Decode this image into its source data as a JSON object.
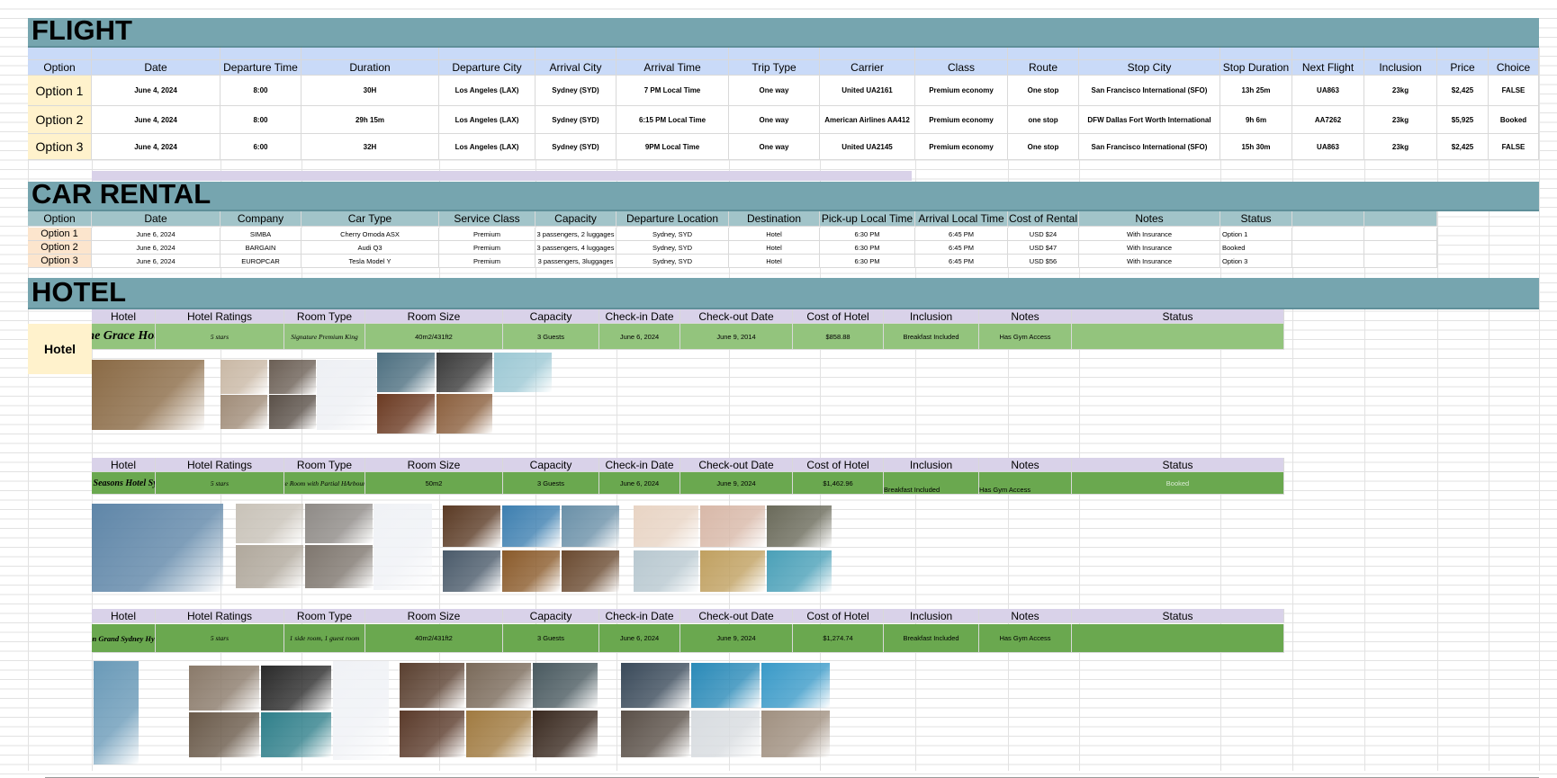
{
  "flight": {
    "title": "FLIGHT",
    "headers": [
      "Option",
      "Date",
      "Departure Time",
      "Duration",
      "Departure City",
      "Arrival City",
      "Arrival Time",
      "Trip Type",
      "Carrier",
      "Class",
      "Route",
      "Stop City",
      "Stop Duration",
      "Next Flight",
      "Inclusion",
      "Price",
      "Choice"
    ],
    "rows": [
      [
        "Option 1",
        "June 4, 2024",
        "8:00",
        "30H",
        "Los Angeles (LAX)",
        "Sydney (SYD)",
        "7 PM Local Time",
        "One way",
        "United UA2161",
        "Premium economy",
        "One stop",
        "San Francisco International (SFO)",
        "13h 25m",
        "UA863",
        "23kg",
        "$2,425",
        "FALSE"
      ],
      [
        "Option 2",
        "June 4, 2024",
        "8:00",
        "29h 15m",
        "Los Angeles (LAX)",
        "Sydney (SYD)",
        "6:15 PM Local Time",
        "One way",
        "American Airlines AA412",
        "Premium economy",
        "one stop",
        "DFW Dallas Fort Worth International",
        "9h 6m",
        "AA7262",
        "23kg",
        "$5,925",
        "Booked"
      ],
      [
        "Option 3",
        "June 4, 2024",
        "6:00",
        "32H",
        "Los Angeles (LAX)",
        "Sydney (SYD)",
        "9PM Local Time",
        "One way",
        "United UA2145",
        "Premium economy",
        "One stop",
        "San Francisco International (SFO)",
        "15h 30m",
        "UA863",
        "23kg",
        "$2,425",
        "FALSE"
      ]
    ]
  },
  "car_rental": {
    "title": "CAR RENTAL",
    "headers": [
      "Option",
      "Date",
      "Company",
      "Car Type",
      "Service Class",
      "Capacity",
      "Departure Location",
      "Destination",
      "Pick-up Local Time",
      "Arrival Local Time",
      "Cost of Rental",
      "Notes",
      "Status",
      "",
      ""
    ],
    "rows": [
      [
        "Option 1",
        "June 6, 2024",
        "SIMBA",
        "Cherry Omoda ASX",
        "Premium",
        "3 passengers, 2 luggages",
        "Sydney, SYD",
        "Hotel",
        "6:30 PM",
        "6:45 PM",
        "USD $24",
        "With Insurance",
        "Option 1"
      ],
      [
        "Option 2",
        "June 6, 2024",
        "BARGAIN",
        "Audi Q3",
        "Premium",
        "3 passengers, 4 luggages",
        "Sydney, SYD",
        "Hotel",
        "6:30 PM",
        "6:45 PM",
        "USD $47",
        "With Insurance",
        "Booked"
      ],
      [
        "Option 3",
        "June 6, 2024",
        "EUROPCAR",
        "Tesla Model Y",
        "Premium",
        "3 passengers, 3luggages",
        "Sydney, SYD",
        "Hotel",
        "6:30 PM",
        "6:45 PM",
        "USD $56",
        "With Insurance",
        "Option 3"
      ]
    ]
  },
  "hotel": {
    "title": "HOTEL",
    "label": "Hotel",
    "headers": [
      "Hotel",
      "Hotel Ratings",
      "Room Type",
      "Room Size",
      "Capacity",
      "Check-in Date",
      "Check-out Date",
      "Cost of Hotel",
      "Inclusion",
      "Notes",
      "Status"
    ],
    "entries": [
      {
        "row": [
          "The Grace Hotel",
          "5 stars",
          "Signature Premium King",
          "40m2/431ft2",
          "3 Guests",
          "June 6, 2024",
          "June 9, 2014",
          "$858.88",
          "Breakfast Included",
          "Has Gym Access",
          ""
        ],
        "color": "#93c47d"
      },
      {
        "row": [
          "Four Seasons Hotel Sydney",
          "5 stars",
          "Deluxe Room with Partial HArbour View",
          "50m2",
          "3 Guests",
          "June 6, 2024",
          "June 9, 2024",
          "$1,462.96",
          "Breakfast Included",
          "Has Gym Access",
          "Booked"
        ],
        "color": "#6aa84f"
      },
      {
        "row": [
          "Sheraton Grand Sydney Hyde Park",
          "5 stars",
          "1 side room, 1 guest room",
          "40m2/431ft2",
          "3 Guests",
          "June 6, 2024",
          "June 9, 2024",
          "$1,274.74",
          "Breakfast Included",
          "Has Gym Access",
          ""
        ],
        "color": "#6aa84f"
      }
    ]
  },
  "colors": {
    "band": "#76a5af",
    "flight_header": "#c9daf8",
    "option_cell": "#fff2cc",
    "car_header": "#a2c4c9",
    "hotel_header": "#d9d2e9"
  }
}
